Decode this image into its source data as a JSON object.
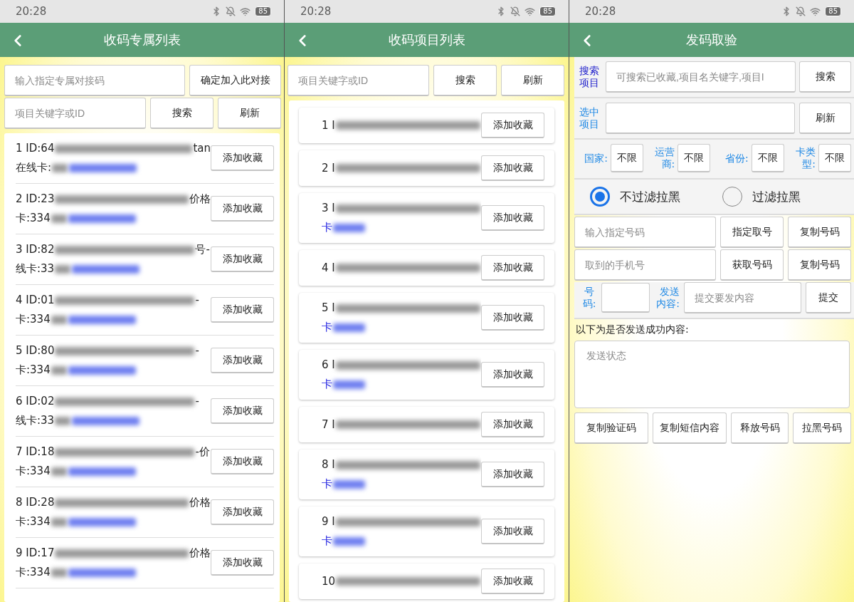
{
  "screens": [
    {
      "kind": "exclusive_list",
      "status_bar": {
        "time": "20:28",
        "battery": "85"
      },
      "title": "收码专属列表",
      "code_field": {
        "placeholder": "输入指定专属对接码"
      },
      "join_button": "确定加入此对接",
      "search_field": {
        "placeholder": "项目关键字或ID"
      },
      "search_button": "搜索",
      "refresh_button": "刷新",
      "rows": [
        {
          "line_1": "1 ID:64",
          "tail": "tan",
          "line_2": "在线卡:",
          "button": "添加收藏"
        },
        {
          "line_1": "2 ID:23",
          "tail": "价格",
          "line_2": "卡:334",
          "button": "添加收藏"
        },
        {
          "line_1": "3 ID:82",
          "tail": "号-",
          "line_2": "线卡:33",
          "button": "添加收藏"
        },
        {
          "line_1": "4 ID:01",
          "tail": "-",
          "line_2": "卡:334",
          "button": "添加收藏"
        },
        {
          "line_1": "5 ID:80",
          "tail": "-",
          "line_2": "卡:334",
          "button": "添加收藏"
        },
        {
          "line_1": "6 ID:02",
          "tail": "-",
          "line_2": "线卡:33",
          "button": "添加收藏"
        },
        {
          "line_1": "7 ID:18",
          "tail": "-价",
          "line_2": "卡:334",
          "button": "添加收藏"
        },
        {
          "line_1": "8 ID:28",
          "tail": "价格",
          "line_2": "卡:334",
          "button": "添加收藏"
        },
        {
          "line_1": "9 ID:17",
          "tail": "价格",
          "line_2": "卡:334",
          "button": "添加收藏"
        }
      ]
    },
    {
      "kind": "project_list",
      "status_bar": {
        "time": "20:28",
        "battery": "85"
      },
      "title": "收码项目列表",
      "search_field": {
        "placeholder": "项目关键字或ID"
      },
      "search_button": "搜索",
      "refresh_button": "刷新",
      "rows": [
        {
          "line_1": "1 I",
          "button": "添加收藏"
        },
        {
          "line_1": "2 I",
          "button": "添加收藏"
        },
        {
          "line_1": "3 I",
          "line_2": "卡",
          "button": "添加收藏"
        },
        {
          "line_1": "4 I",
          "button": "添加收藏"
        },
        {
          "line_1": "5 I",
          "line_2": "卡",
          "button": "添加收藏"
        },
        {
          "line_1": "6 I",
          "line_2": "卡",
          "button": "添加收藏"
        },
        {
          "line_1": "7 I",
          "button": "添加收藏"
        },
        {
          "line_1": "8 I",
          "line_2": "卡",
          "button": "添加收藏"
        },
        {
          "line_1": "9 I",
          "line_2": "卡",
          "button": "添加收藏"
        },
        {
          "line_1": "10",
          "button": "添加收藏"
        }
      ]
    },
    {
      "kind": "send_verify",
      "status_bar": {
        "time": "20:28",
        "battery": "85"
      },
      "title": "发码取验",
      "search": {
        "label": "搜索项目",
        "placeholder": "可搜索已收藏,项目名关键字,项目I",
        "button": "搜索"
      },
      "selected": {
        "label": "选中项目",
        "button": "刷新"
      },
      "filters": [
        {
          "label": "国家:",
          "value": "不限"
        },
        {
          "label": "运营商:",
          "value": "不限"
        },
        {
          "label": "省份:",
          "value": "不限"
        },
        {
          "label": "卡类型:",
          "value": "不限"
        }
      ],
      "radios": [
        {
          "label": "不过滤拉黑",
          "selected": true
        },
        {
          "label": "过滤拉黑",
          "selected": false
        }
      ],
      "number_row": {
        "placeholder": "输入指定号码",
        "buttons": [
          "指定取号",
          "复制号码"
        ]
      },
      "phone_row": {
        "placeholder": "取到的手机号",
        "buttons": [
          "获取号码",
          "复制号码"
        ]
      },
      "send_row": {
        "number_label": "号码:",
        "content_label": "发送内容:",
        "placeholder": "提交要发内容",
        "button": "提交"
      },
      "result_label": "以下为是否发送成功内容:",
      "status_box": {
        "placeholder": "发送状态"
      },
      "actions": [
        "复制验证码",
        "复制短信内容",
        "释放号码",
        "拉黑号码"
      ]
    }
  ]
}
